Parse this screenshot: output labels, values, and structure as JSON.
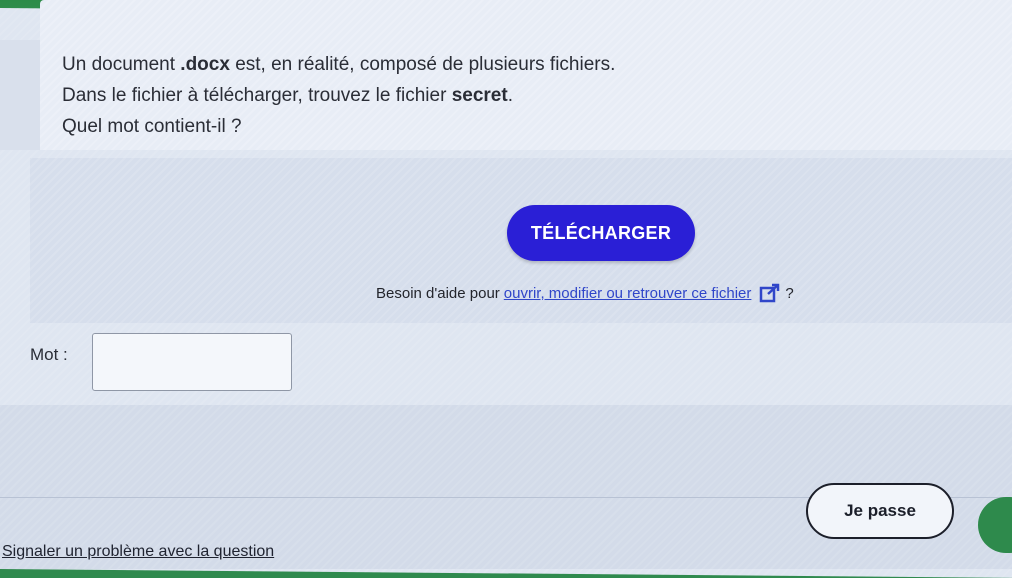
{
  "instructions": {
    "line1_pre": "Un document ",
    "line1_bold": ".docx",
    "line1_post": " est, en réalité, composé de plusieurs fichiers.",
    "line2_pre": "Dans le fichier à télécharger, trouvez le fichier ",
    "line2_bold": "secret",
    "line2_post": ".",
    "line3": "Quel mot contient-il ?"
  },
  "download": {
    "button_label": "TÉLÉCHARGER"
  },
  "help": {
    "prefix": "Besoin d'aide pour ",
    "link_text": "ouvrir, modifier ou retrouver ce fichier",
    "suffix": " ?",
    "icon": "external-link-icon"
  },
  "answer": {
    "label": "Mot :",
    "value": "",
    "placeholder": ""
  },
  "actions": {
    "pass_label": "Je passe",
    "report_label": "Signaler un problème avec la question"
  },
  "colors": {
    "primary": "#2a1fd6",
    "background_green": "#2f8a4e",
    "panel": "#dfe6f1"
  }
}
